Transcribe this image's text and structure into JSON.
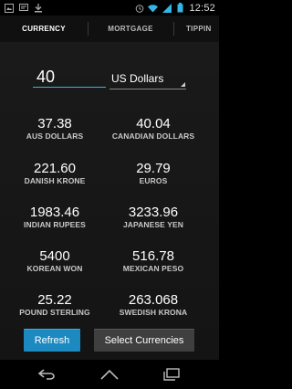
{
  "status_bar": {
    "time": "12:52",
    "left_icons": [
      "gallery-icon",
      "message-icon",
      "download-icon"
    ],
    "right_icons": [
      "alarm-icon",
      "wifi-icon",
      "signal-icon",
      "battery-icon"
    ]
  },
  "tabs": [
    {
      "label": "CURRENCY",
      "selected": true
    },
    {
      "label": "MORTGAGE",
      "selected": false
    },
    {
      "label": "TIPPIN",
      "selected": false
    }
  ],
  "converter": {
    "amount": "40",
    "from_currency": "US Dollars"
  },
  "results": [
    {
      "value": "37.38",
      "label": "AUS DOLLARS"
    },
    {
      "value": "40.04",
      "label": "CANADIAN DOLLARS"
    },
    {
      "value": "221.60",
      "label": "DANISH KRONE"
    },
    {
      "value": "29.79",
      "label": "EUROS"
    },
    {
      "value": "1983.46",
      "label": "INDIAN RUPEES"
    },
    {
      "value": "3233.96",
      "label": "JAPANESE YEN"
    },
    {
      "value": "5400",
      "label": "KOREAN WON"
    },
    {
      "value": "516.78",
      "label": "MEXICAN PESO"
    },
    {
      "value": "25.22",
      "label": "POUND STERLING"
    },
    {
      "value": "263.068",
      "label": "SWEDISH KRONA"
    }
  ],
  "buttons": {
    "refresh_label": "Refresh",
    "select_label": "Select Currencies"
  },
  "colors": {
    "accent": "#33b5e5",
    "refresh_button": "#1c8ac0",
    "select_button": "#3f3f3f"
  },
  "nav_bar": [
    "back-icon",
    "home-icon",
    "recent-apps-icon"
  ]
}
